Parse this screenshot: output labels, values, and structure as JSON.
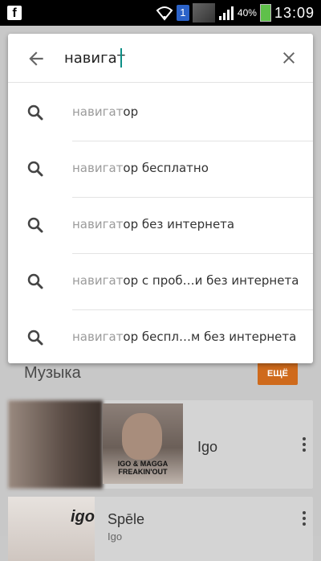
{
  "status_bar": {
    "app_icon": "facebook-icon",
    "sim_badge": "1",
    "battery_pct": "40%",
    "time": "13:09"
  },
  "search": {
    "query": "навигат",
    "back_icon": "arrow-left-icon",
    "clear_icon": "close-icon",
    "suggestions": [
      {
        "match": "навигат",
        "rest": "ор",
        "icon": "search-icon"
      },
      {
        "match": "навигат",
        "rest": "ор бесплатно",
        "icon": "search-icon"
      },
      {
        "match": "навигат",
        "rest": "ор без интернета",
        "icon": "search-icon"
      },
      {
        "match": "навигат",
        "rest": "ор с проб…и без интернета",
        "icon": "search-icon"
      },
      {
        "match": "навигат",
        "rest": "ор беспл…м без интернета",
        "icon": "search-icon"
      }
    ]
  },
  "music_section": {
    "title": "Музыка",
    "more_label": "ЕЩЁ",
    "more_color": "#cf6a1c",
    "cards": [
      {
        "title": "Igo",
        "art_caption": "IGO & MAGGA FREAKIN'OUT"
      },
      {
        "title": "Spēle",
        "subtitle": "Igo",
        "logo": "igo"
      }
    ]
  }
}
